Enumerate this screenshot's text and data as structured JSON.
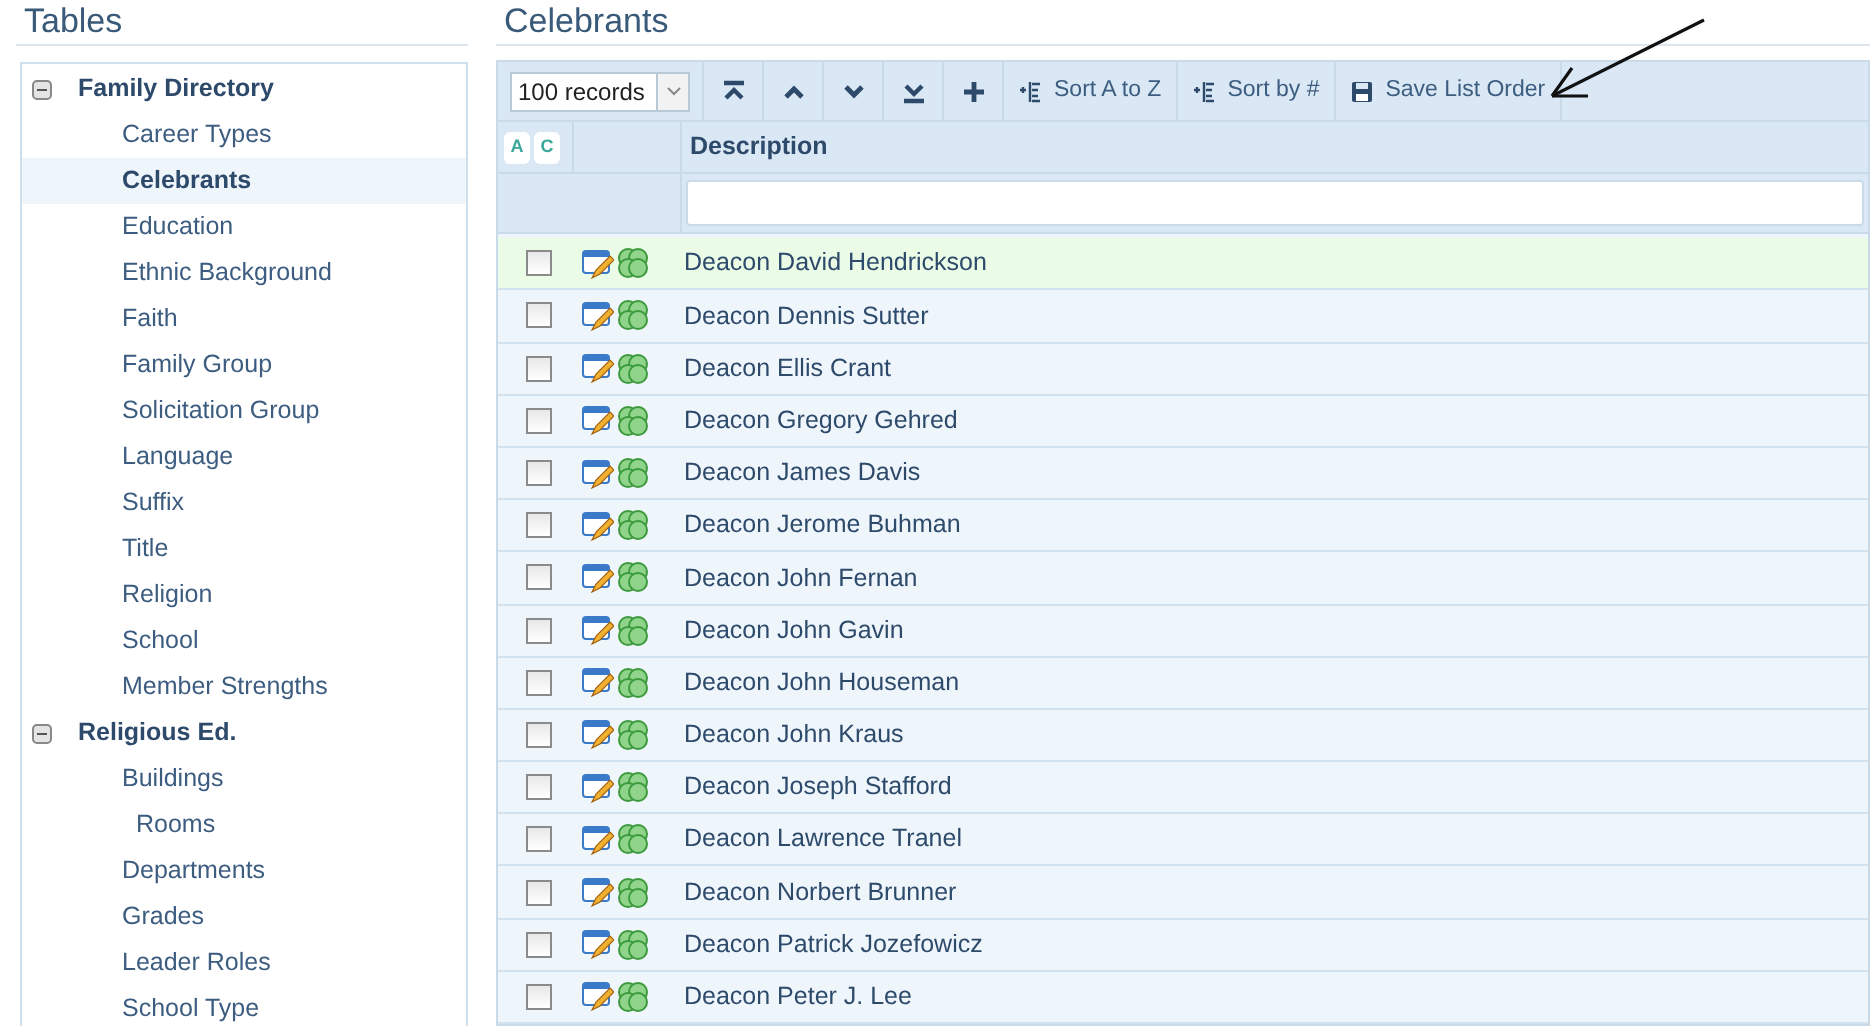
{
  "sidebar": {
    "title": "Tables",
    "groups": [
      {
        "label": "Family Directory",
        "expanded": true,
        "children": [
          {
            "label": "Career Types",
            "selected": false
          },
          {
            "label": "Celebrants",
            "selected": true
          },
          {
            "label": "Education",
            "selected": false
          },
          {
            "label": "Ethnic Background",
            "selected": false
          },
          {
            "label": "Faith",
            "selected": false
          },
          {
            "label": "Family Group",
            "selected": false
          },
          {
            "label": "Solicitation Group",
            "selected": false
          },
          {
            "label": "Language",
            "selected": false
          },
          {
            "label": "Suffix",
            "selected": false
          },
          {
            "label": "Title",
            "selected": false
          },
          {
            "label": "Religion",
            "selected": false
          },
          {
            "label": "School",
            "selected": false
          },
          {
            "label": "Member Strengths",
            "selected": false
          }
        ]
      },
      {
        "label": "Religious Ed.",
        "expanded": true,
        "children": [
          {
            "label": "Buildings",
            "selected": false,
            "children": [
              {
                "label": "Rooms",
                "selected": false
              }
            ]
          },
          {
            "label": "Departments",
            "selected": false
          },
          {
            "label": "Grades",
            "selected": false
          },
          {
            "label": "Leader Roles",
            "selected": false
          },
          {
            "label": "School Type",
            "selected": false
          }
        ]
      }
    ]
  },
  "main": {
    "title": "Celebrants",
    "toolbar": {
      "page_size": "100 records",
      "buttons": [
        {
          "kind": "top"
        },
        {
          "kind": "up"
        },
        {
          "kind": "down"
        },
        {
          "kind": "bottom"
        },
        {
          "kind": "add"
        },
        {
          "kind": "sort",
          "label": "Sort A to Z"
        },
        {
          "kind": "sort",
          "label": "Sort by #"
        },
        {
          "kind": "save",
          "label": "Save List Order"
        }
      ]
    },
    "header": {
      "toggles": [
        "A",
        "C"
      ],
      "column": "Description"
    },
    "rows": [
      {
        "description": "Deacon David Hendrickson",
        "checked": false,
        "selected": true
      },
      {
        "description": "Deacon Dennis Sutter",
        "checked": false,
        "selected": false
      },
      {
        "description": "Deacon Ellis Crant",
        "checked": false,
        "selected": false
      },
      {
        "description": "Deacon Gregory Gehred",
        "checked": false,
        "selected": false
      },
      {
        "description": "Deacon James Davis",
        "checked": false,
        "selected": false
      },
      {
        "description": "Deacon Jerome Buhman",
        "checked": false,
        "selected": false
      },
      {
        "description": "Deacon John Fernan",
        "checked": false,
        "selected": false
      },
      {
        "description": "Deacon John Gavin",
        "checked": false,
        "selected": false
      },
      {
        "description": "Deacon John Houseman",
        "checked": false,
        "selected": false
      },
      {
        "description": "Deacon John Kraus",
        "checked": false,
        "selected": false
      },
      {
        "description": "Deacon Joseph Stafford",
        "checked": false,
        "selected": false
      },
      {
        "description": "Deacon Lawrence Tranel",
        "checked": false,
        "selected": false
      },
      {
        "description": "Deacon Norbert Brunner",
        "checked": false,
        "selected": false
      },
      {
        "description": "Deacon Patrick Jozefowicz",
        "checked": false,
        "selected": false
      },
      {
        "description": "Deacon Peter J. Lee",
        "checked": false,
        "selected": false
      }
    ]
  }
}
